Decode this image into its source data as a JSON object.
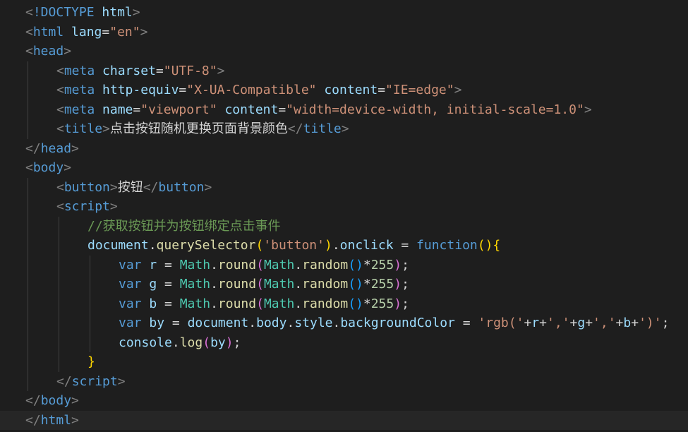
{
  "editor": {
    "language": "html",
    "theme_colors": {
      "background": "#1e1e1e",
      "tag": "#569cd6",
      "attribute": "#9cdcfe",
      "string": "#ce9178",
      "comment": "#6a9955",
      "class": "#4ec9b0",
      "function": "#dcdcaa",
      "number": "#b5cea8",
      "bracket_1": "#ffd700",
      "bracket_2": "#da70d6",
      "bracket_3": "#179fff"
    }
  },
  "code": {
    "doctype_kw": "!DOCTYPE",
    "html": "html",
    "lang_attr": "lang",
    "lang_val": "\"en\"",
    "head": "head",
    "meta": "meta",
    "charset_attr": "charset",
    "charset_val": "\"UTF-8\"",
    "http_equiv_attr": "http-equiv",
    "http_equiv_val": "\"X-UA-Compatible\"",
    "content_attr": "content",
    "ie_edge_val": "\"IE=edge\"",
    "name_attr": "name",
    "viewport_val": "\"viewport\"",
    "viewport_content_val": "\"width=device-width, initial-scale=1.0\"",
    "title": "title",
    "title_text": "点击按钮随机更换页面背景颜色",
    "body": "body",
    "button": "button",
    "button_text": "按钮",
    "script": "script",
    "comment": "//获取按钮并为按钮绑定点击事件",
    "document": "document",
    "querySelector": "querySelector",
    "selector_str": "'button'",
    "onclick": "onclick",
    "function_kw": "function",
    "var_kw": "var",
    "r": "r",
    "g": "g",
    "b": "b",
    "Math": "Math",
    "round": "round",
    "random": "random",
    "num_255": "255",
    "by": "by",
    "body_prop": "body",
    "style": "style",
    "backgroundColor": "backgroundColor",
    "rgb_open_str": "'rgb('",
    "comma_str": "','",
    "close_str": "')'",
    "console": "console",
    "log": "log"
  }
}
